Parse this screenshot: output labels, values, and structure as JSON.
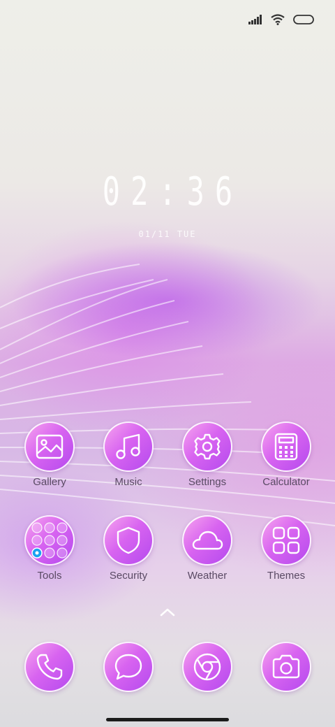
{
  "status_bar": {
    "icons": [
      "signal-icon",
      "wifi-icon",
      "battery-icon"
    ]
  },
  "lockclock": {
    "time": "02:36",
    "date": "01/11 TUE"
  },
  "apps": [
    {
      "label": "Gallery",
      "icon": "gallery-icon"
    },
    {
      "label": "Music",
      "icon": "music-icon"
    },
    {
      "label": "Settings",
      "icon": "gear-icon"
    },
    {
      "label": "Calculator",
      "icon": "calculator-icon"
    },
    {
      "label": "Tools",
      "icon": "tools-folder-icon"
    },
    {
      "label": "Security",
      "icon": "shield-icon"
    },
    {
      "label": "Weather",
      "icon": "cloud-icon"
    },
    {
      "label": "Themes",
      "icon": "themes-icon"
    }
  ],
  "dock": [
    {
      "icon": "phone-icon"
    },
    {
      "icon": "message-icon"
    },
    {
      "icon": "browser-icon"
    },
    {
      "icon": "camera-icon"
    }
  ],
  "colors": {
    "icon_gradient": [
      "#f6a4ee",
      "#d864f0",
      "#b54aee"
    ],
    "label_text": "#5a4a64",
    "accent_dot": "#1aa2f0"
  }
}
